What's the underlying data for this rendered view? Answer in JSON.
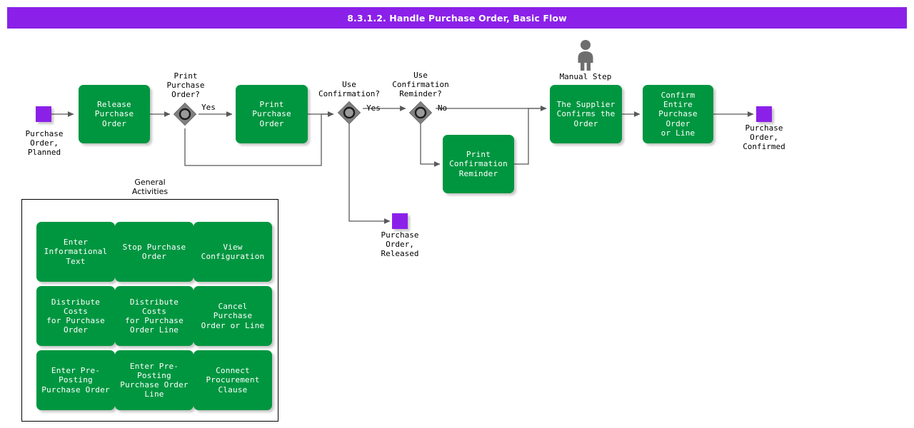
{
  "title": "8.3.1.2. Handle Purchase Order, Basic Flow",
  "colors": {
    "banner": "#8B21E8",
    "task": "#009640",
    "terminator": "#8B21E8",
    "decision": "#808080",
    "connector": "#595959",
    "text_on_task": "#FFFFFF",
    "label_text": "#000000"
  },
  "flow": {
    "start": {
      "icon": "terminator-square",
      "label": "Purchase\nOrder,\nPlanned"
    },
    "tasks": {
      "release_purchase_order": "Release\nPurchase Order",
      "print_purchase_order": "Print Purchase\nOrder",
      "print_confirmation_reminder": "Print\nConfirmation\nReminder",
      "supplier_confirms_order": "The Supplier\nConfirms the\nOrder",
      "confirm_entire_order": "Confirm Entire\nPurchase Order\nor Line"
    },
    "decisions": {
      "print_purchase_order": {
        "label": "Print\nPurchase\nOrder?",
        "yes_label": "Yes"
      },
      "use_confirmation": {
        "label": "Use\nConfirmation?",
        "yes_label": "Yes"
      },
      "use_confirmation_reminder": {
        "label": "Use\nConfirmation\nReminder?",
        "no_label": "No"
      }
    },
    "manual_step_label": "Manual Step",
    "manual_step_icon": "person-icon",
    "ends": {
      "released": {
        "icon": "terminator-square",
        "label": "Purchase\nOrder,\nReleased"
      },
      "confirmed": {
        "icon": "terminator-square",
        "label": "Purchase\nOrder,\nConfirmed"
      }
    }
  },
  "general_activities": {
    "title": "General\nActivities",
    "items": [
      "Enter\nInformational\nText",
      "Stop Purchase\nOrder",
      "View\nConfiguration",
      "Distribute Costs\nfor Purchase\nOrder",
      "Distribute Costs\nfor Purchase\nOrder Line",
      "Cancel Purchase\nOrder or Line",
      "Enter Pre-\nPosting\nPurchase Order",
      "Enter Pre-\nPosting\nPurchase Order\nLine",
      "Connect\nProcurement\nClause"
    ]
  }
}
